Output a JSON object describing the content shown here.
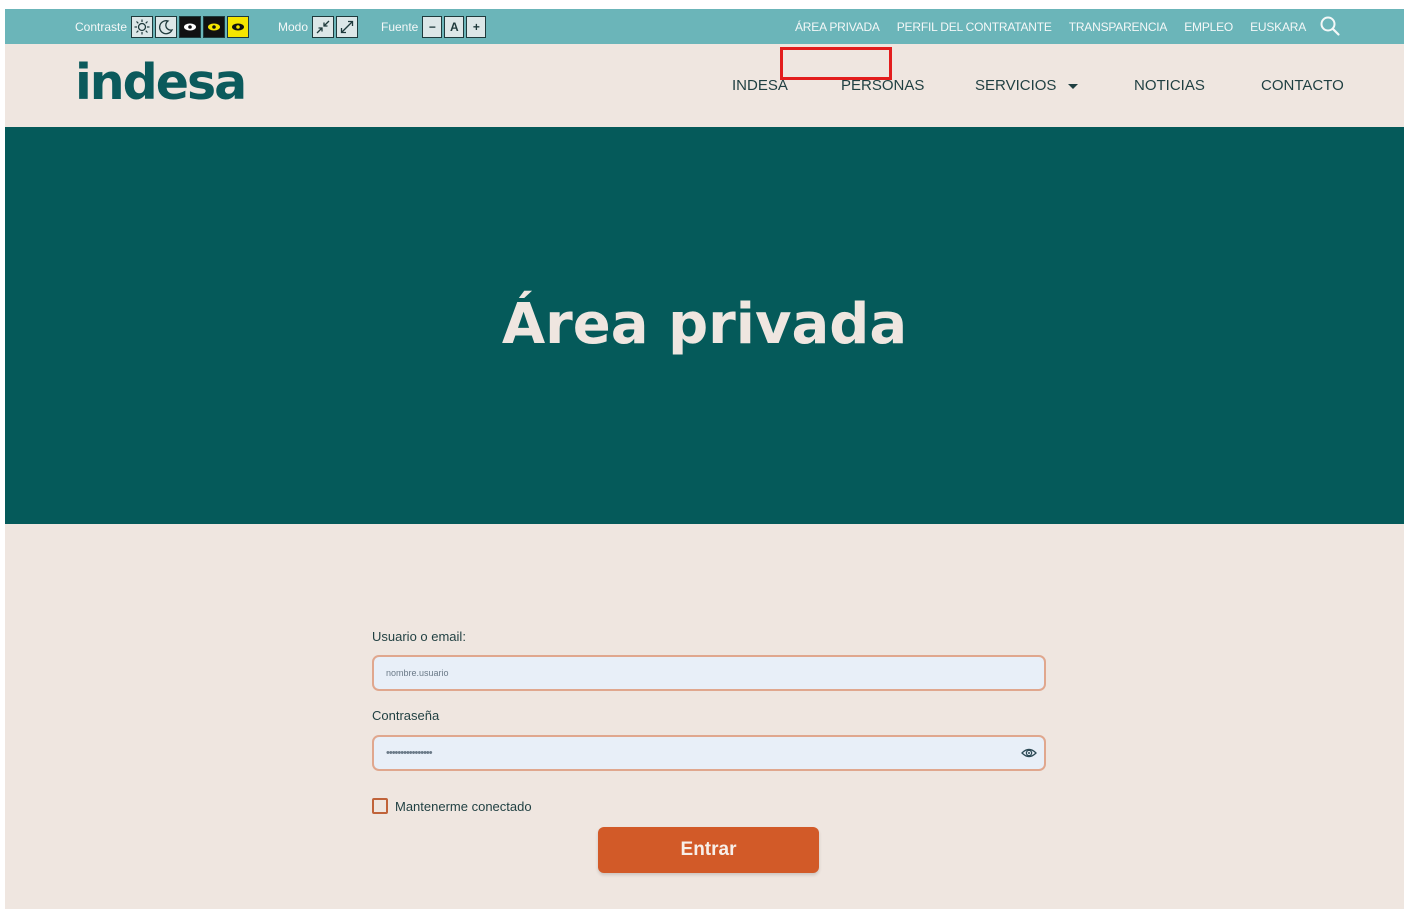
{
  "topbar": {
    "contrast_label": "Contraste",
    "mode_label": "Modo",
    "font_label": "Fuente",
    "font_buttons": [
      "−",
      "A",
      "+"
    ],
    "links": [
      "ÁREA PRIVADA",
      "PERFIL DEL CONTRATANTE",
      "TRANSPARENCIA",
      "EMPLEO",
      "EUSKARA"
    ],
    "search_icon": "search-icon"
  },
  "header": {
    "logo": "indesa",
    "nav": [
      "INDESA",
      "PERSONAS",
      "SERVICIOS",
      "NOTICIAS",
      "CONTACTO"
    ]
  },
  "hero": {
    "title": "Área privada"
  },
  "login_form": {
    "username_label": "Usuario o email:",
    "username_value": "nombre.usuario",
    "password_label": "Contraseña",
    "password_value": "••••••••••••••••",
    "remember_label": "Mantenerme conectado",
    "submit_label": "Entrar"
  },
  "colors": {
    "topbar": "#6bb5b9",
    "background": "#efe6e0",
    "hero": "#055a5a",
    "button": "#d25a28",
    "highlight": "#e31d1d"
  }
}
